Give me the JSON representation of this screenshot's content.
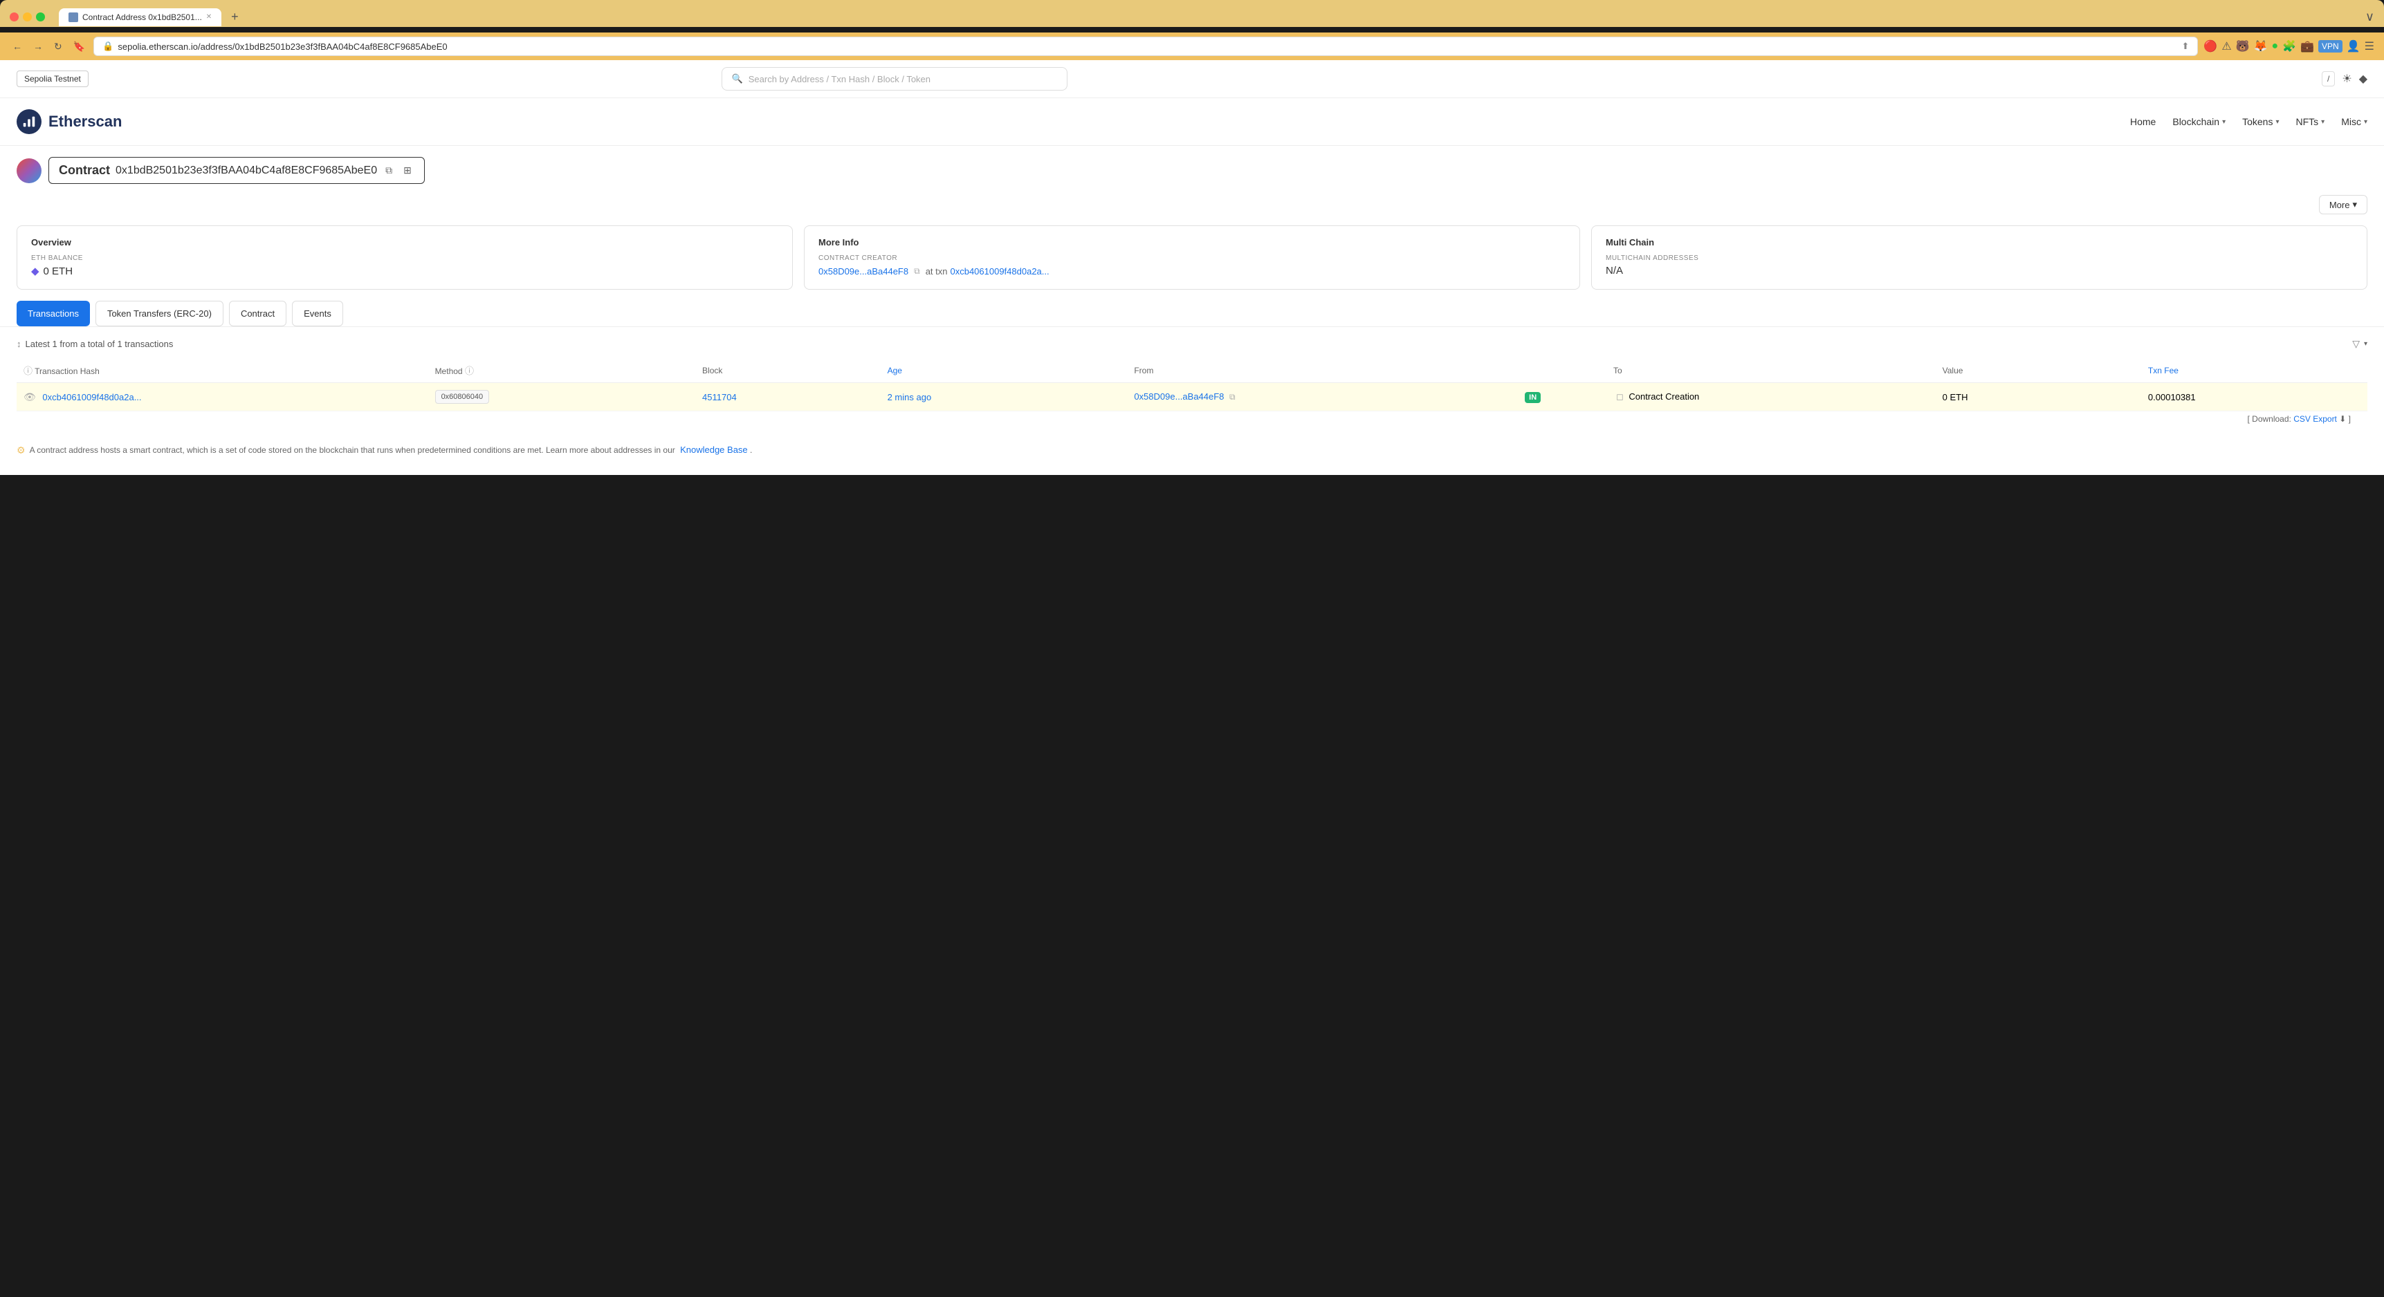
{
  "browser": {
    "tab_title": "Contract Address 0x1bdB2501...",
    "url": "sepolia.etherscan.io/address/0x1bdB2501b23e3f3fBAA04bC4af8E8CF9685AbeE0",
    "new_tab_label": "+"
  },
  "topnav": {
    "testnet_label": "Sepolia Testnet",
    "search_placeholder": "Search by Address / Txn Hash / Block / Token"
  },
  "header": {
    "logo_text": "Etherscan",
    "nav": {
      "home": "Home",
      "blockchain": "Blockchain",
      "tokens": "Tokens",
      "nfts": "NFTs",
      "misc": "Misc"
    }
  },
  "contract": {
    "label": "Contract",
    "address": "0x1bdB2501b23e3f3fBAA04bC4af8E8CF9685AbeE0"
  },
  "more_btn": "More",
  "overview": {
    "title": "Overview",
    "eth_balance_label": "ETH BALANCE",
    "eth_balance_value": "0 ETH"
  },
  "more_info": {
    "title": "More Info",
    "contract_creator_label": "CONTRACT CREATOR",
    "creator_address": "0x58D09e...aBa44eF8",
    "at_txn_text": "at txn",
    "txn_address": "0xcb4061009f48d0a2a..."
  },
  "multi_chain": {
    "title": "Multi Chain",
    "multichain_label": "MULTICHAIN ADDRESSES",
    "value": "N/A"
  },
  "tabs": {
    "transactions": "Transactions",
    "token_transfers": "Token Transfers (ERC-20)",
    "contract": "Contract",
    "events": "Events"
  },
  "table": {
    "summary": "Latest 1 from a total of 1 transactions",
    "columns": {
      "txhash": "Transaction Hash",
      "method": "Method",
      "block": "Block",
      "age": "Age",
      "from": "From",
      "to": "To",
      "value": "Value",
      "txfee": "Txn Fee"
    },
    "rows": [
      {
        "txhash": "0xcb4061009f48d0a2a...",
        "method": "0x60806040",
        "block": "4511704",
        "age": "2 mins ago",
        "from": "0x58D09e...aBa44eF8",
        "direction": "IN",
        "to_icon": "contract-icon",
        "to_label": "Contract Creation",
        "value": "0 ETH",
        "txfee": "0.00010381"
      }
    ]
  },
  "footer": {
    "csv_label": "[ Download:",
    "csv_link": "CSV Export",
    "csv_suffix": "]",
    "note": "A contract address hosts a smart contract, which is a set of code stored on the blockchain that runs when predetermined conditions are met. Learn more about addresses in our",
    "knowledge_base": "Knowledge Base",
    "period": "."
  }
}
